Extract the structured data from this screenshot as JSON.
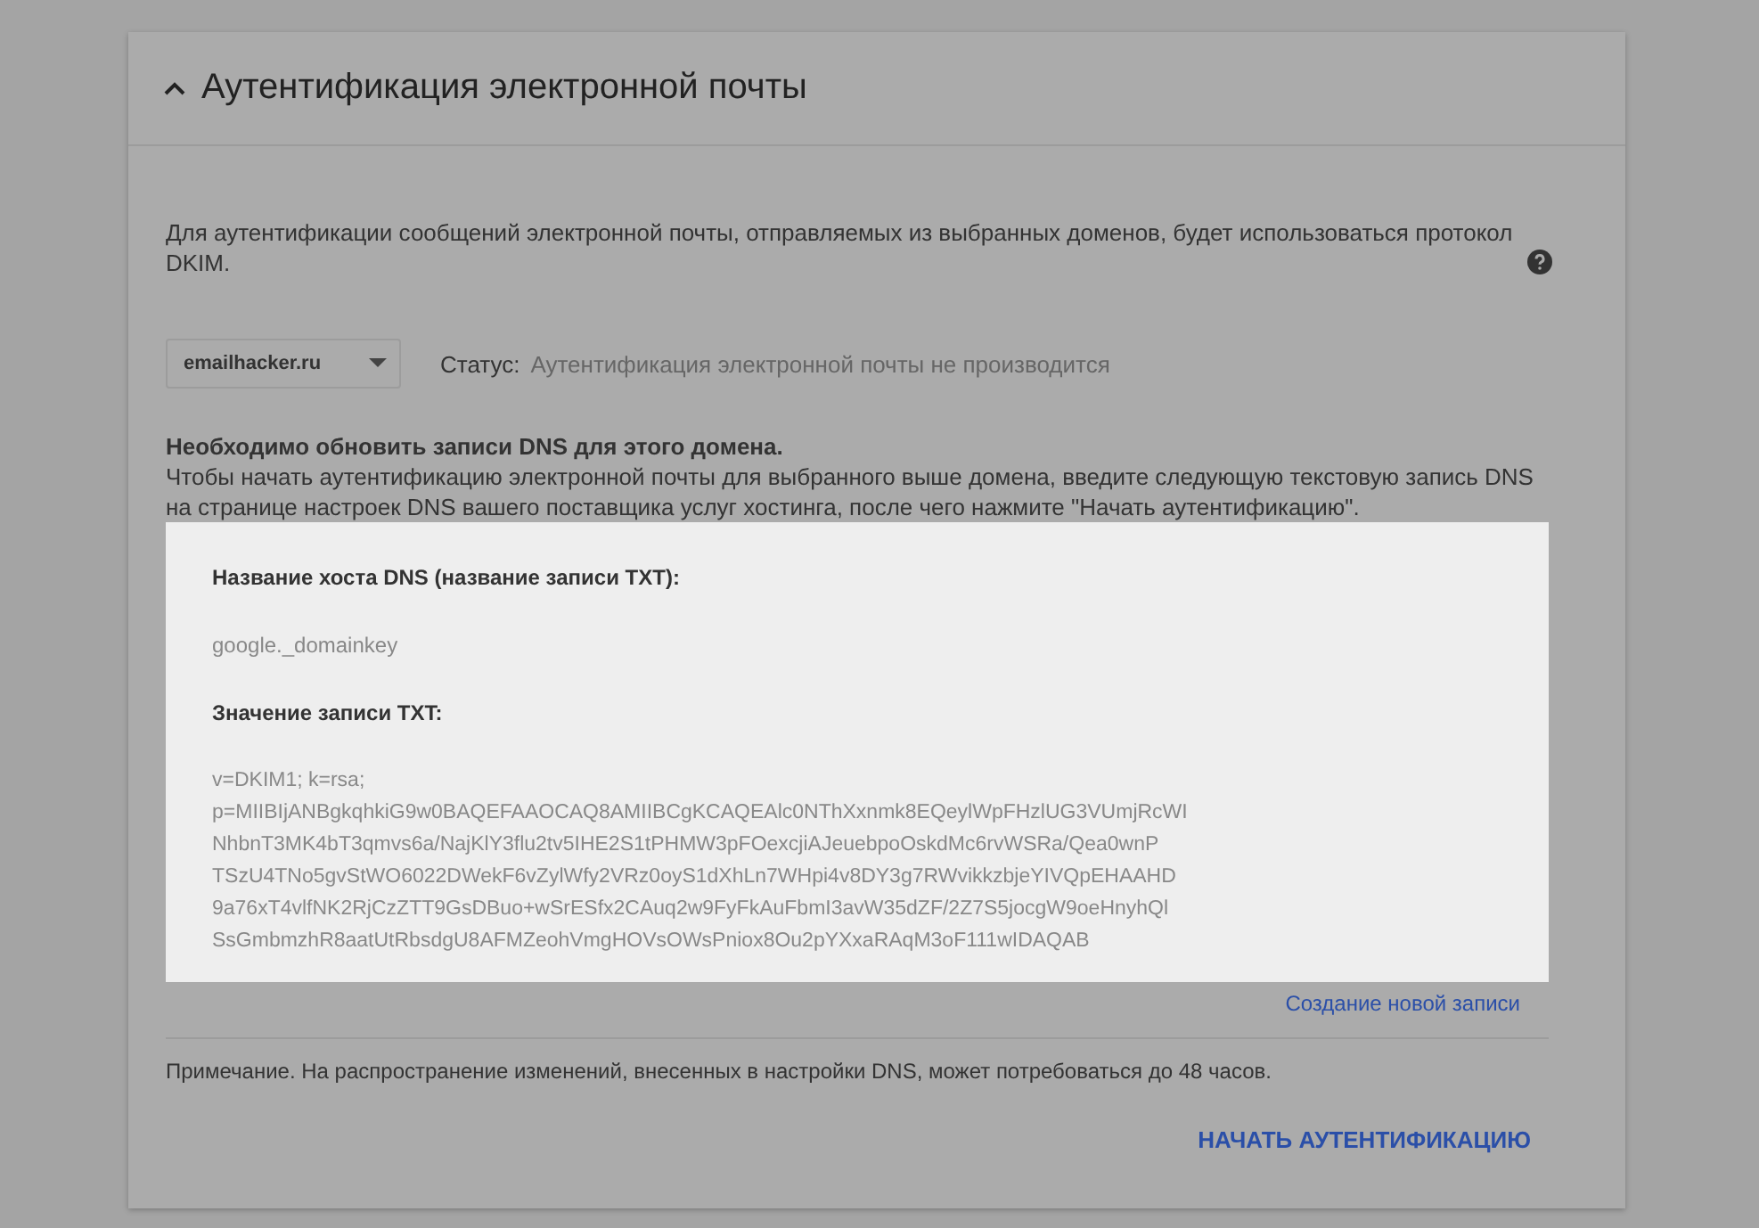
{
  "section": {
    "title": "Аутентификация электронной почты",
    "expanded": true
  },
  "description": "Для аутентификации сообщений электронной почты, отправляемых из выбранных доменов, будет использоваться протокол DKIM.",
  "domain_select": {
    "value": "emailhacker.ru"
  },
  "status": {
    "label": "Статус:",
    "value": "Аутентификация электронной почты не производится"
  },
  "notice": {
    "heading": "Необходимо обновить записи DNS для этого домена.",
    "text": "Чтобы начать аутентификацию электронной почты для выбранного выше домена, введите следующую текстовую запись DNS на странице настроек DNS вашего поставщика услуг хостинга, после чего нажмите \"Начать аутентификацию\"."
  },
  "record": {
    "host_label": "Название хоста DNS (название записи TXT):",
    "host_value": "google._domainkey",
    "value_label": "Значение записи TXT:",
    "value_lines": [
      "v=DKIM1; k=rsa;",
      "p=MIIBIjANBgkqhkiG9w0BAQEFAAOCAQ8AMIIBCgKCAQEAlc0NThXxnmk8EQeylWpFHzlUG3VUmjRcWI",
      "NhbnT3MK4bT3qmvs6a/NajKlY3flu2tv5IHE2S1tPHMW3pFOexcjiAJeuebpoOskdMc6rvWSRa/Qea0wnP",
      "TSzU4TNo5gvStWO6022DWekF6vZylWfy2VRz0oyS1dXhLn7WHpi4v8DY3g7RWvikkzbjeYIVQpEHAAHD",
      "9a76xT4vlfNK2RjCzZTT9GsDBuo+wSrESfx2CAuq2w9FyFkAuFbmI3avW35dZF/2Z7S5jocgW9oeHnyhQl",
      "SsGmbmzhR8aatUtRbsdgU8AFMZeohVmgHOVsOWsPniox8Ou2pYXxaRAqM3oF111wIDAQAB"
    ]
  },
  "create_link": "Создание новой записи",
  "note": "Примечание. На распространение изменений, внесенных в настройки DNS, может потребоваться до 48 часов.",
  "start_button": "НАЧАТЬ АУТЕНТИФИКАЦИЮ"
}
